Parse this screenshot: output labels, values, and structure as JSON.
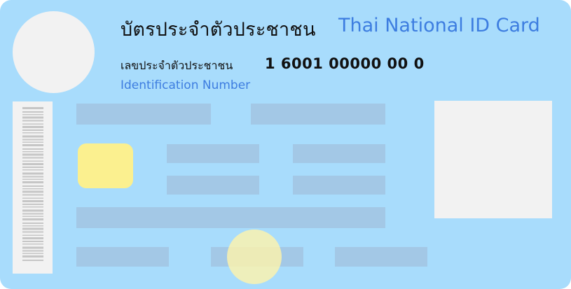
{
  "card": {
    "title_th": "บัตรประจำตัวประชาชน",
    "title_en": "Thai National ID Card",
    "id_label_th": "เลขประจำตัวประชาชน",
    "id_number": "1 6001 00000 00 0",
    "id_label_en": "Identification Number"
  },
  "colors": {
    "card_background": "#a8dcfc",
    "title_en": "#3d7de0",
    "chip": "#fbf08f",
    "placeholder_field": "#a3c8e6",
    "photo_placeholder": "#f2f2f2"
  }
}
